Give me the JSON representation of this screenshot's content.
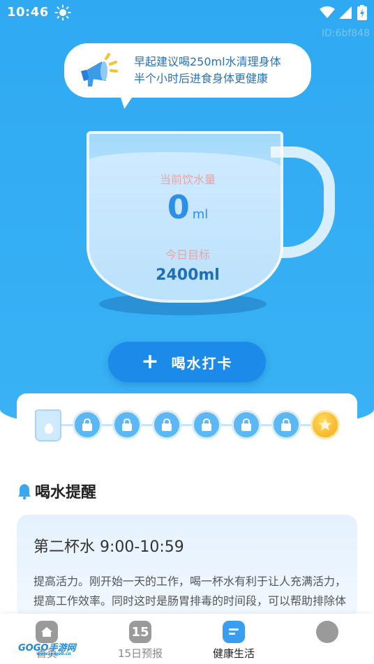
{
  "status_bar": {
    "time": "10:46"
  },
  "watermark_id": "ID:6bf848",
  "tip": {
    "lines": [
      "早起建议喝250ml水清理身体",
      "半个小时后进食身体更健康"
    ]
  },
  "cup": {
    "current_label": "当前饮水量",
    "current_value": "0",
    "current_unit": "ml",
    "target_label": "今日目标",
    "target_value": "2400ml",
    "water_level_fraction": 0
  },
  "checkin_button": {
    "icon": "plus-icon",
    "label": "喝水打卡"
  },
  "progress": {
    "total_cups": 8,
    "completed": 0,
    "final_reward_icon": "star-icon"
  },
  "reminder": {
    "heading": "喝水提醒",
    "card_title": "第二杯水  9:00-10:59",
    "card_body": "提高活力。刚开始一天的工作，喝一杯水有利于让人充满活力，提高工作效率。同时这时是肠胃排毒的时间段，可以帮助排除体内毒素。"
  },
  "bottom_nav": {
    "items": [
      {
        "label": "首页",
        "icon": "home-icon"
      },
      {
        "label": "15日预报",
        "icon": "calendar-15-icon",
        "badge": "15"
      },
      {
        "label": "健康生活",
        "icon": "health-icon",
        "active": true
      },
      {
        "label": "",
        "icon": "profile-icon"
      }
    ]
  },
  "logo": {
    "text": "GOGO手游网",
    "sub": "www.gogo8.cn"
  },
  "colors": {
    "primary": "#2fa9f2",
    "button": "#1b8ae8",
    "accent_text": "#2b72b8"
  }
}
